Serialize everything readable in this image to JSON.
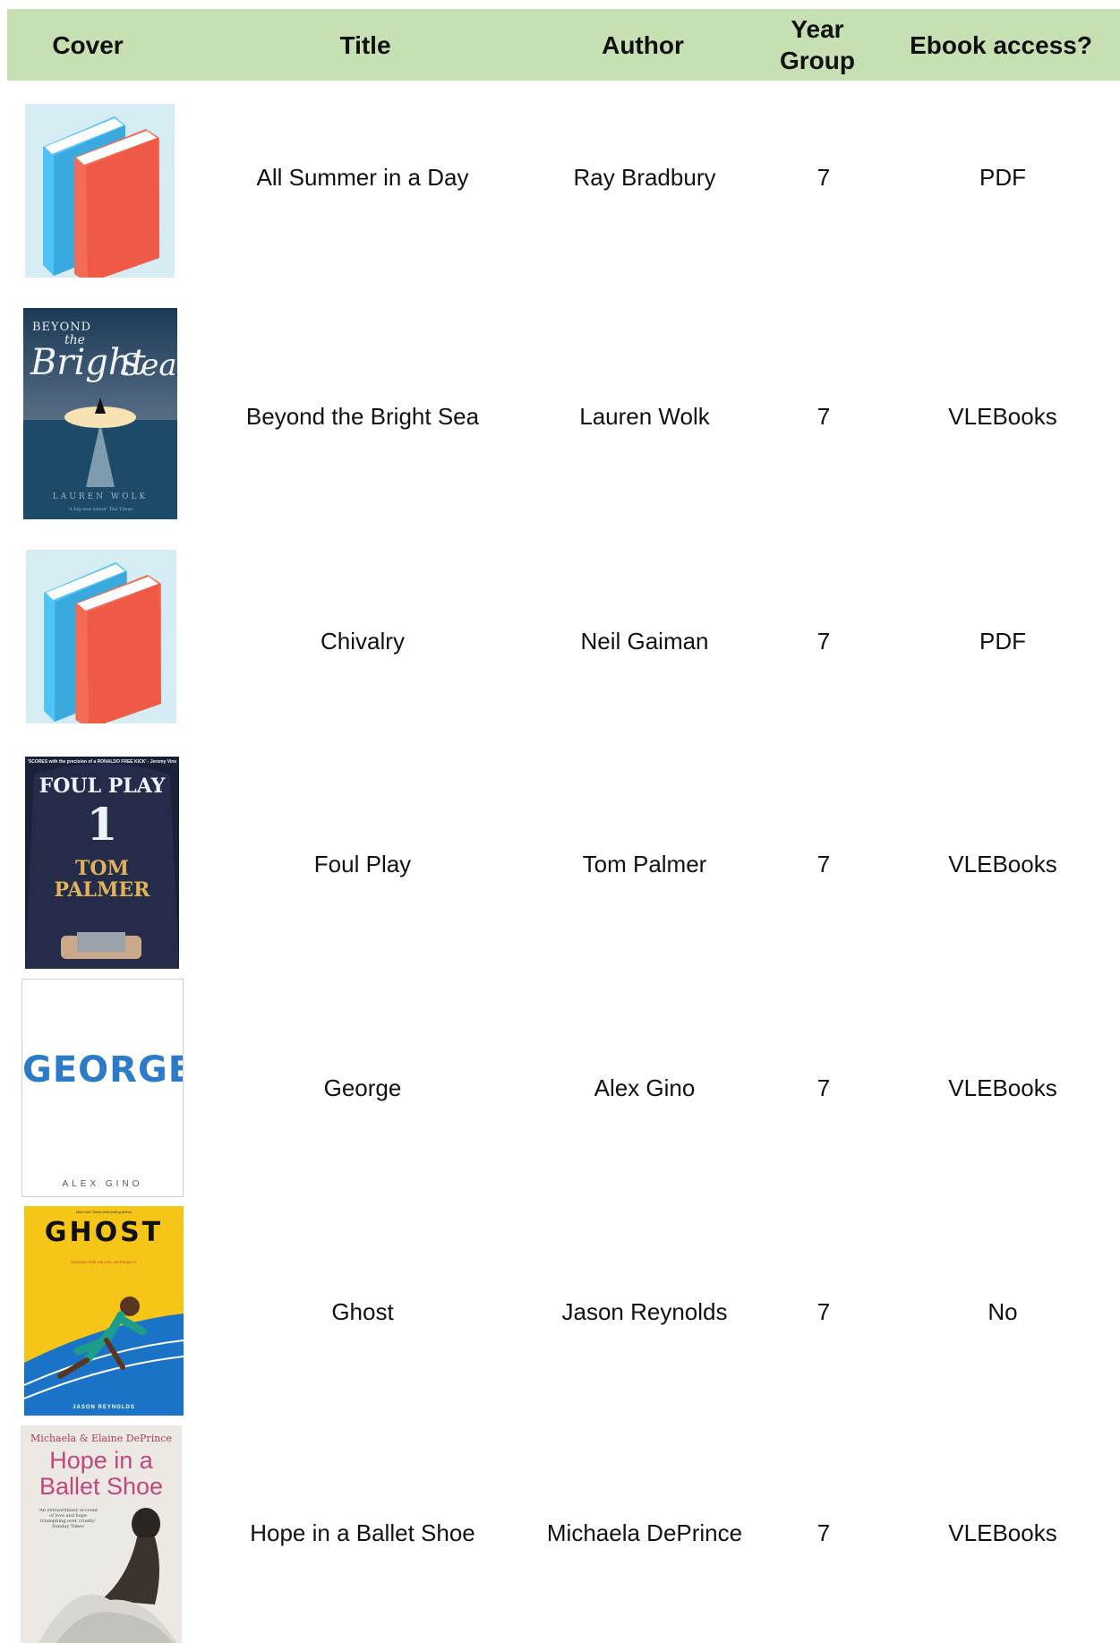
{
  "table": {
    "headers": {
      "cover": "Cover",
      "title": "Title",
      "author": "Author",
      "year_group": "Year Group",
      "ebook_access": "Ebook access?"
    },
    "rows": [
      {
        "title": "All Summer in a Day",
        "author": "Ray Bradbury",
        "year": "7",
        "ebook": "PDF",
        "cover": "generic-book-icon"
      },
      {
        "title": "Beyond the Bright Sea",
        "author": "Lauren Wolk",
        "year": "7",
        "ebook": "VLEBooks",
        "cover": "beyond-the-bright-sea-cover",
        "cover_text": {
          "title_line1": "BEYOND",
          "title_line2": "the",
          "title_line3": "Bright",
          "title_line4": "Sea",
          "author": "LAUREN WOLK",
          "quote": "'A big new talent' The Times"
        }
      },
      {
        "title": "Chivalry",
        "author": "Neil Gaiman",
        "year": "7",
        "ebook": "PDF",
        "cover": "generic-book-icon"
      },
      {
        "title": "Foul Play",
        "author": "Tom Palmer",
        "year": "7",
        "ebook": "VLEBooks",
        "cover": "foul-play-cover",
        "cover_text": {
          "tagline": "'SCORES with the precision of a RONALDO FREE KICK' - Jeremy Vine",
          "title": "FOUL PLAY",
          "number": "1",
          "author_line1": "TOM",
          "author_line2": "PALMER"
        }
      },
      {
        "title": "George",
        "author": "Alex Gino",
        "year": "7",
        "ebook": "VLEBooks",
        "cover": "george-cover",
        "cover_text": {
          "title": "GEORGE",
          "author": "ALEX GINO"
        }
      },
      {
        "title": "Ghost",
        "author": "Jason Reynolds",
        "year": "7",
        "ebook": "No",
        "cover": "ghost-cover",
        "cover_text": {
          "kicker": "New York Times best-selling author",
          "title": "GHOST",
          "tagline": "RUNNING FOR HIS LIFE, OR FROM IT?",
          "author": "JASON REYNOLDS"
        }
      },
      {
        "title": "Hope in a Ballet Shoe",
        "author": "Michaela DePrince",
        "year": "7",
        "ebook": "VLEBooks",
        "cover": "hope-in-a-ballet-shoe-cover",
        "cover_text": {
          "authors": "Michaela & Elaine DePrince",
          "title_line1": "Hope in a",
          "title_line2": "Ballet Shoe",
          "quote": "'An extraordinary account of love and hope triumphing over cruelty' Sunday Times"
        }
      }
    ]
  },
  "colors": {
    "header_bg": "#c6e0b4",
    "icon_bg": "#d6ecf3",
    "book_blue": "#4fc3f7",
    "book_red": "#ee5a46",
    "ghost_yellow": "#f5c518"
  }
}
